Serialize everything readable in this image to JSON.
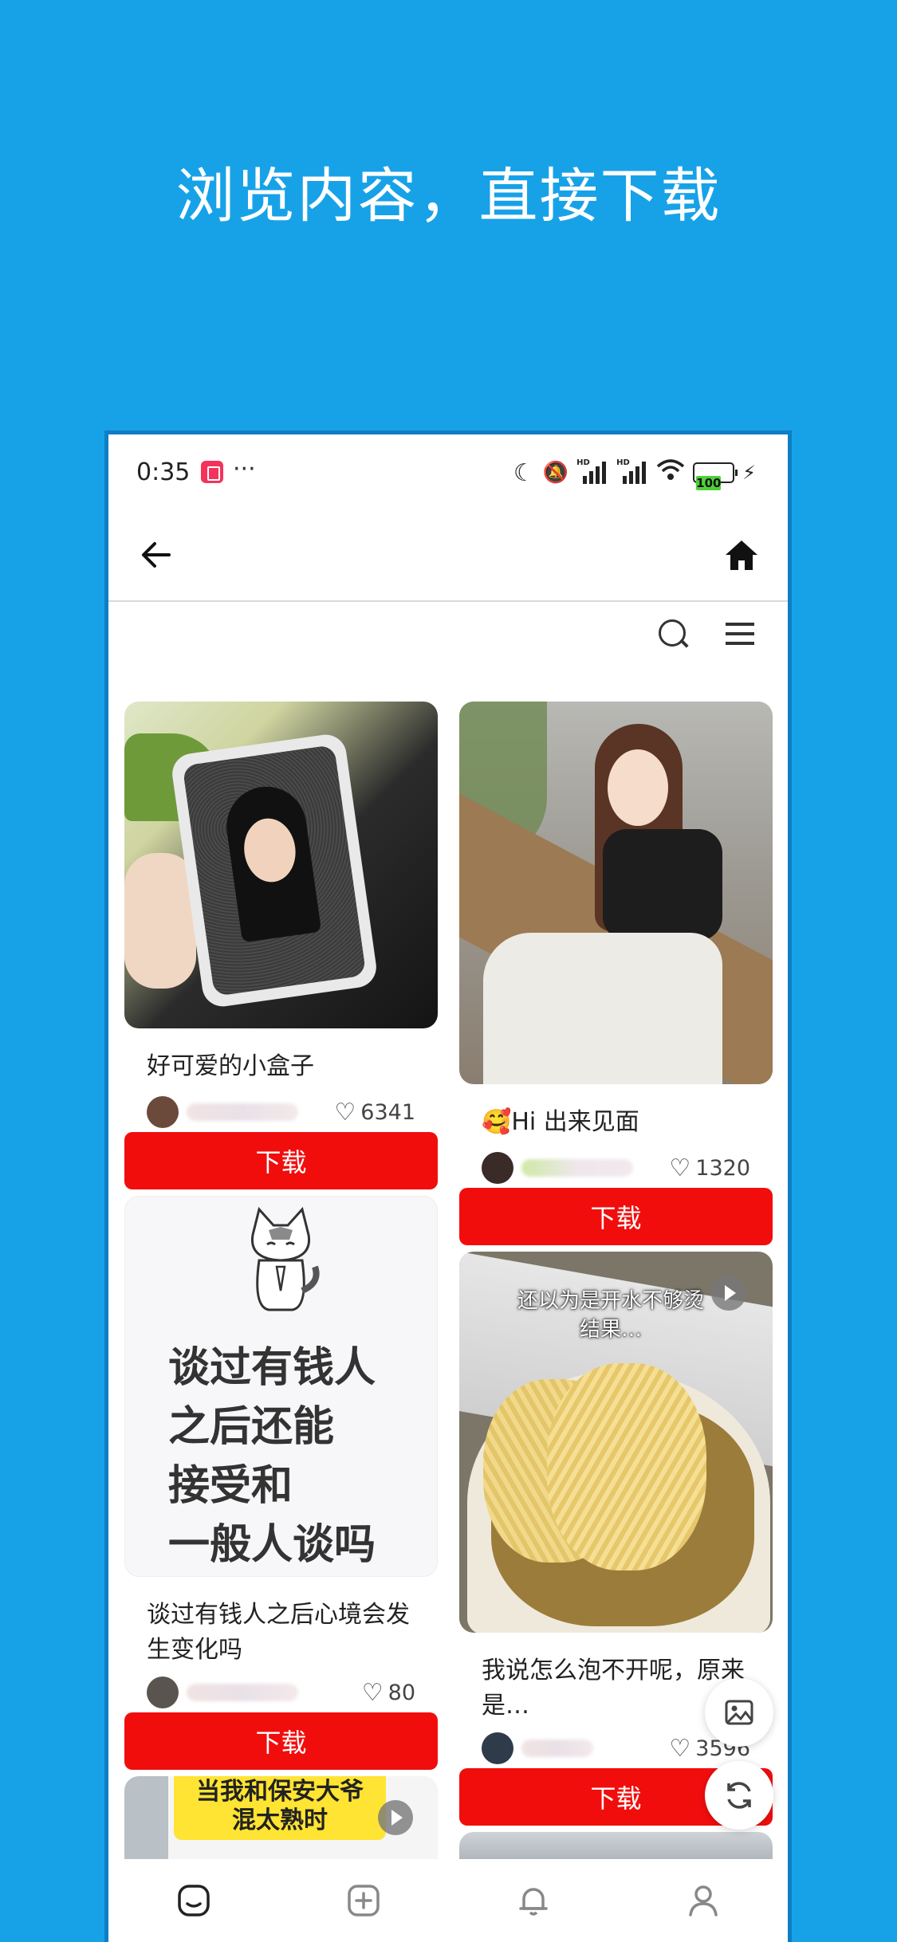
{
  "headline": "浏览内容，直接下载",
  "status": {
    "time": "0:35",
    "dots": "···",
    "battery": "100"
  },
  "feed": {
    "left": [
      {
        "title": "好可爱的小盒子",
        "likes": "6341",
        "button": "下载"
      },
      {
        "title": "谈过有钱人之后心境会发生变化吗",
        "likes": "80",
        "button": "下载",
        "image_text": [
          "谈过有钱人",
          "之后还能",
          "接受和",
          "一般人谈吗"
        ]
      },
      {
        "caption": [
          "当我和保安大爷",
          "混太熟时"
        ]
      }
    ],
    "right": [
      {
        "title": "🥰Hi 出来见面",
        "likes": "1320",
        "button": "下载"
      },
      {
        "title": "我说怎么泡不开呢，原来是…",
        "likes": "3596",
        "button": "下载",
        "image_text": [
          "还以为是开水不够烫",
          "结果…"
        ]
      }
    ]
  },
  "colors": {
    "brand_blue": "#17A2E8",
    "download_red": "#F20D0D"
  },
  "icons": [
    "back-arrow-icon",
    "home-icon",
    "search-icon",
    "menu-icon",
    "image-icon",
    "refresh-icon",
    "feed-tab-icon",
    "add-tab-icon",
    "bell-tab-icon",
    "profile-tab-icon"
  ]
}
